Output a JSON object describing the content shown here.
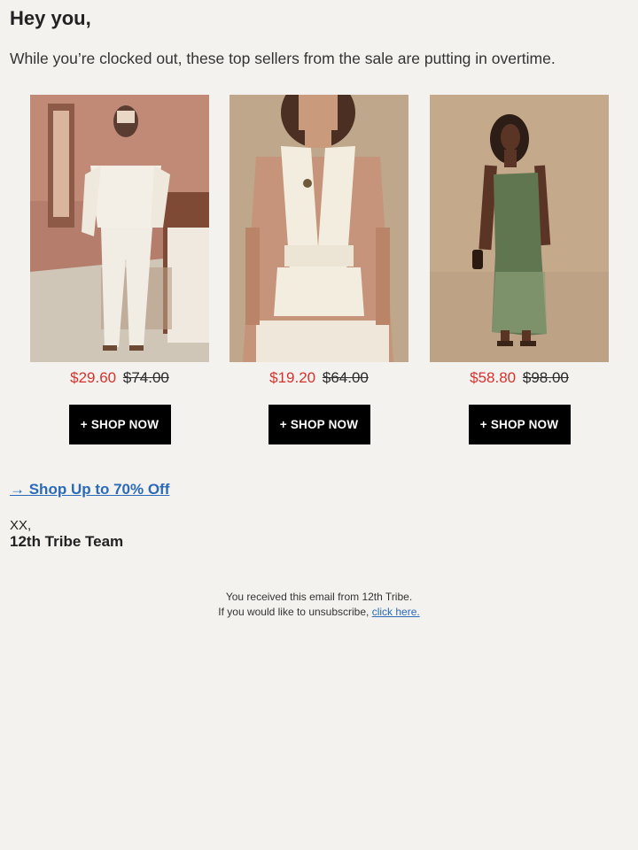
{
  "email": {
    "greeting": "Hey you,",
    "intro": "While you’re clocked out, these top sellers from the sale are putting in overtime."
  },
  "products": [
    {
      "sale_price": "$29.60",
      "original_price": "$74.00",
      "button_label": "+ SHOP NOW",
      "image_icon": "product-photo-white-wide-leg-set"
    },
    {
      "sale_price": "$19.20",
      "original_price": "$64.00",
      "button_label": "+ SHOP NOW",
      "image_icon": "product-photo-cream-halter-top"
    },
    {
      "sale_price": "$58.80",
      "original_price": "$98.00",
      "button_label": "+ SHOP NOW",
      "image_icon": "product-photo-green-strapless-dress"
    }
  ],
  "cta": {
    "label": "→ Shop Up to 70% Off"
  },
  "signoff": {
    "line1": "XX,",
    "line2": "12th Tribe Team"
  },
  "footer": {
    "line1": "You received this email from 12th Tribe.",
    "line2": "If you would like to unsubscribe,",
    "link": "click here."
  },
  "colors": {
    "background": "#f4f2ef",
    "sale_price": "#d8312c",
    "link": "#2a6ab8",
    "button": "#000000"
  }
}
